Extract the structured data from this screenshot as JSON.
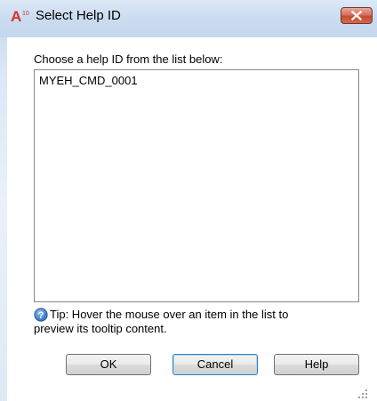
{
  "window": {
    "title": "Select Help ID",
    "app_icon_text": "A",
    "app_icon_version": "10"
  },
  "dialog": {
    "prompt": "Choose a help ID from the list below:",
    "list_items": [
      "MYEH_CMD_0001"
    ],
    "tip_line1": "Tip: Hover the mouse over an item in the list to",
    "tip_line2": "preview its tooltip content."
  },
  "buttons": {
    "ok": "OK",
    "cancel": "Cancel",
    "help": "Help"
  },
  "colors": {
    "app_icon": "#d1312f",
    "close_button": "#c54a31",
    "tip_icon": "#2f6fbf"
  },
  "icons": {
    "app": "autocad-logo-icon",
    "close": "close-icon",
    "tip": "help-question-icon",
    "resize": "resize-grip-icon"
  }
}
